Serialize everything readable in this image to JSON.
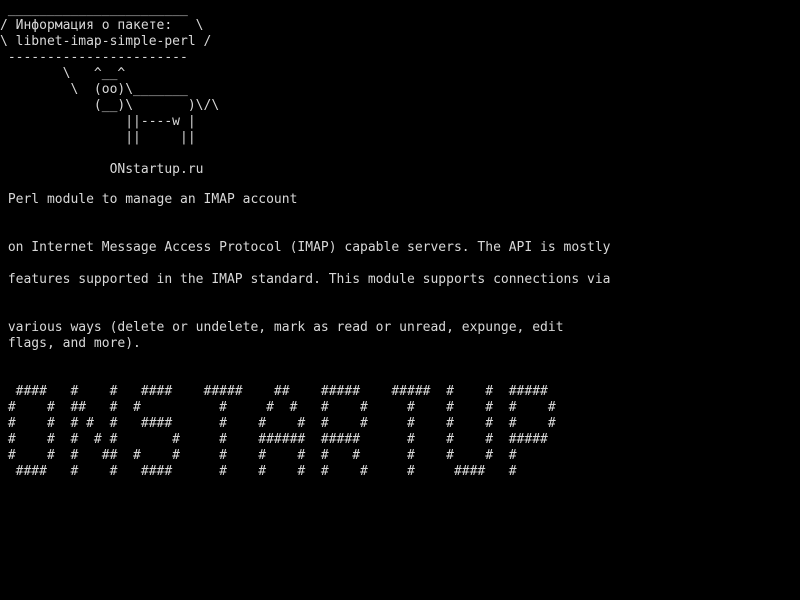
{
  "screen": {
    "background": "#000000",
    "foreground": "#d8d8d8"
  },
  "cowsay": {
    "text": " _______________________\n/ Информация о пакете:   \\\n\\ libnet-imap-simple-perl /\n -----------------------\n        \\   ^__^\n         \\  (oo)\\_______\n            (__)\\       )\\/\\\n                ||----w |\n                ||     ||\n\n              ONstartup.ru"
  },
  "description": {
    "line1": " Perl module to manage an IMAP account",
    "line2": " on Internet Message Access Protocol (IMAP) capable servers. The API is mostly",
    "line3": " features supported in the IMAP standard. This module supports connections via",
    "line4": " various ways (delete or undelete, mark as read or unread, expunge, edit\n flags, and more)."
  },
  "banner": {
    "text": "  ####   #    #   ####    #####    ##    #####    #####  #    #  #####\n #    #  ##   #  #          #     #  #   #    #     #    #    #  #    #\n #    #  # #  #   ####      #    #    #  #    #     #    #    #  #    #\n #    #  #  # #       #     #    ######  #####      #    #    #  #####\n #    #  #   ##  #    #     #    #    #  #   #      #    #    #  #\n  ####   #    #   ####      #    #    #  #    #     #     ####   #"
  }
}
